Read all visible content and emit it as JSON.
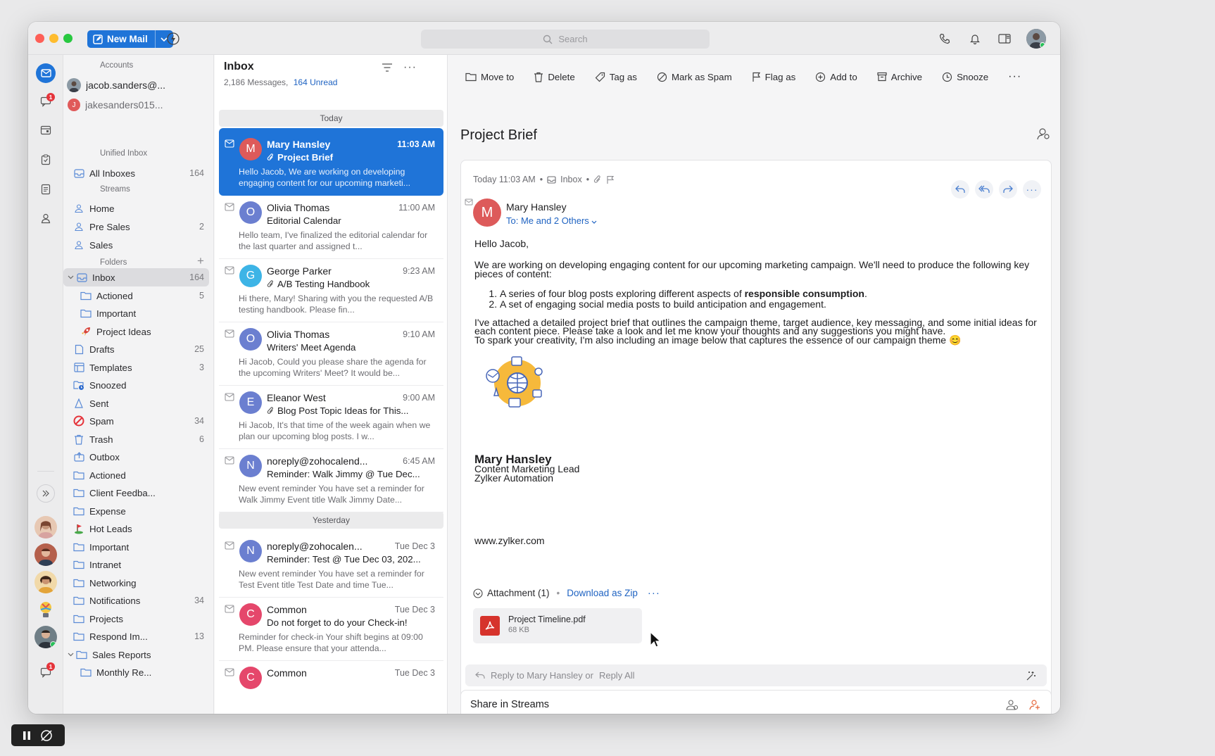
{
  "toolbar": {
    "new_mail": "New Mail",
    "search_placeholder": "Search"
  },
  "nav": {
    "accounts_title": "Accounts",
    "accounts": [
      {
        "label": "jacob.sanders@..."
      },
      {
        "label": "jakesanders015..."
      }
    ],
    "unified_title": "Unified Inbox",
    "all_inboxes": {
      "label": "All Inboxes",
      "count": "164"
    },
    "streams_title": "Streams",
    "streams": [
      {
        "label": "Home",
        "count": ""
      },
      {
        "label": "Pre Sales",
        "count": "2"
      },
      {
        "label": "Sales",
        "count": ""
      }
    ],
    "folders_title": "Folders",
    "folders": [
      {
        "label": "Inbox",
        "count": "164"
      },
      {
        "label": "Actioned",
        "count": "5"
      },
      {
        "label": "Important",
        "count": ""
      },
      {
        "label": "Project Ideas",
        "count": ""
      },
      {
        "label": "Drafts",
        "count": "25"
      },
      {
        "label": "Templates",
        "count": "3"
      },
      {
        "label": "Snoozed",
        "count": ""
      },
      {
        "label": "Sent",
        "count": ""
      },
      {
        "label": "Spam",
        "count": "34"
      },
      {
        "label": "Trash",
        "count": "6"
      },
      {
        "label": "Outbox",
        "count": ""
      },
      {
        "label": "Actioned",
        "count": ""
      },
      {
        "label": "Client Feedba...",
        "count": ""
      },
      {
        "label": "Expense",
        "count": ""
      },
      {
        "label": "Hot Leads",
        "count": ""
      },
      {
        "label": "Important",
        "count": ""
      },
      {
        "label": "Intranet",
        "count": ""
      },
      {
        "label": "Networking",
        "count": ""
      },
      {
        "label": "Notifications",
        "count": "34"
      },
      {
        "label": "Projects",
        "count": ""
      },
      {
        "label": "Respond Im...",
        "count": "13"
      },
      {
        "label": "Sales Reports",
        "count": ""
      },
      {
        "label": "Monthly Re...",
        "count": ""
      }
    ],
    "rail_badges": {
      "chat": "1",
      "bottom": "1"
    }
  },
  "list": {
    "title": "Inbox",
    "total": "2,186 Messages,",
    "unread": "164 Unread",
    "day_today": "Today",
    "day_yesterday": "Yesterday",
    "messages": [
      {
        "initial": "M",
        "color": "#dd5a5a",
        "from": "Mary Hansley",
        "time": "11:03 AM",
        "subject": "Project Brief",
        "preview": "Hello Jacob, We are working on developing engaging content for our upcoming marketi..."
      },
      {
        "initial": "O",
        "color": "#6b7fd0",
        "from": "Olivia Thomas",
        "time": "11:00 AM",
        "subject": "Editorial Calendar",
        "preview": "Hello team, I've finalized the editorial calendar for the last quarter and assigned t..."
      },
      {
        "initial": "G",
        "color": "#3db4e6",
        "from": "George Parker",
        "time": "9:23 AM",
        "subject": "A/B Testing Handbook",
        "preview": "Hi there, Mary! Sharing with you the requested A/B testing handbook. Please fin..."
      },
      {
        "initial": "O",
        "color": "#6b7fd0",
        "from": "Olivia Thomas",
        "time": "9:10 AM",
        "subject": "Writers' Meet Agenda",
        "preview": "Hi Jacob, Could you please share the agenda for the upcoming Writers' Meet? It would be..."
      },
      {
        "initial": "E",
        "color": "#6b7fd0",
        "from": "Eleanor West",
        "time": "9:00 AM",
        "subject": "Blog Post Topic Ideas for This...",
        "preview": "Hi Jacob, It's that time of the week again when we plan our upcoming blog posts. I w..."
      },
      {
        "initial": "N",
        "color": "#6b7fd0",
        "from": "noreply@zohocalend...",
        "time": "6:45 AM",
        "subject": "Reminder: Walk Jimmy @ Tue Dec...",
        "preview": "New event reminder You have set a reminder for Walk Jimmy Event title Walk Jimmy Date..."
      },
      {
        "initial": "N",
        "color": "#6b7fd0",
        "from": "noreply@zohocalen...",
        "time": "Tue Dec 3",
        "subject": "Reminder: Test @ Tue Dec 03, 202...",
        "preview": "New event reminder You have set a reminder for Test Event title Test Date and time Tue..."
      },
      {
        "initial": "C",
        "color": "#e5476b",
        "from": "Common",
        "time": "Tue Dec 3",
        "subject": "Do not forget to do your Check-in!",
        "preview": "Reminder for check-in Your shift begins at 09:00 PM. Please ensure that your attenda..."
      },
      {
        "initial": "C",
        "color": "#e5476b",
        "from": "Common",
        "time": "Tue Dec 3",
        "subject": "",
        "preview": ""
      }
    ]
  },
  "reader": {
    "actions": [
      "Move to",
      "Delete",
      "Tag as",
      "Mark as Spam",
      "Flag as",
      "Add to",
      "Archive",
      "Snooze"
    ],
    "subject": "Project Brief",
    "meta_time": "Today 11:03 AM",
    "meta_folder": "Inbox",
    "sender": "Mary Hansley",
    "to": "To: Me and 2 Others",
    "greeting": "Hello Jacob,",
    "para1": "We are working on developing engaging content for our upcoming marketing campaign. We'll need to produce the following key pieces of content:",
    "item1_pre": "A series of four blog posts exploring different aspects of ",
    "item1_bold": "responsible consumption",
    "item1_post": ".",
    "item2": "A set of engaging social media posts to build anticipation and engagement.",
    "para2a": "I've attached a detailed project brief that outlines the campaign theme, target audience, key messaging, and some initial ideas for each content piece. Please take a look and let me know your thoughts and any suggestions you might have.",
    "para2b": "To spark your creativity, I'm also including an image below that captures the essence of our campaign theme 😊",
    "sig_name": "Mary Hansley",
    "sig_role": "Content Marketing Lead",
    "sig_company": "Zylker Automation",
    "website": "www.zylker.com",
    "attachment_title": "Attachment (1)",
    "download_zip": "Download as Zip",
    "file_name": "Project Timeline.pdf",
    "file_size": "68 KB",
    "reply_to": "Reply to Mary Hansley or",
    "reply_all": "Reply All",
    "share_streams": "Share in Streams"
  },
  "colors": {
    "accent": "#1f74d8",
    "link": "#1f63c2"
  }
}
